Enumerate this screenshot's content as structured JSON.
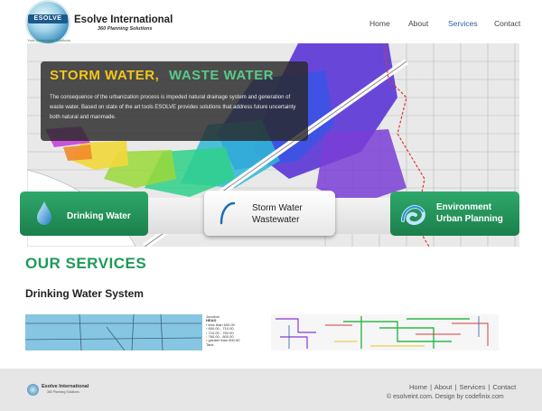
{
  "header": {
    "logo_band": "ESOLVE",
    "logo_tagline": "Your Sustainable Solutions",
    "brand_name": "Esolve International",
    "brand_sub": "360 Planning Solutions",
    "nav": [
      "Home",
      "About",
      "Services",
      "Contact"
    ],
    "active_nav": "Services"
  },
  "hero": {
    "title_part1": "STORM WATER,",
    "title_part2": "WASTE WATER",
    "text": "The consequence of the urbanization process is impeded natural drainage system and generation of waste water. Based on state of the art tools ESOLVE provides solutions that address future uncertainty both natural and manmade."
  },
  "service_cards": [
    {
      "label_line1": "Drinking Water",
      "label_line2": ""
    },
    {
      "label_line1": "Storm Water",
      "label_line2": "Wastewater"
    },
    {
      "label_line1": "Environment",
      "label_line2": "Urban Planning"
    }
  ],
  "services": {
    "heading": "OUR SERVICES",
    "subsection": "Drinking Water System",
    "legend_title": "Junction",
    "legend_sub": "HEAD",
    "legend_items": [
      "less than 600.00",
      "600.00 - 710.00",
      "710.00 - 760.00",
      "760.00 - 800.00",
      "greater than 800.00"
    ],
    "legend_footer": "Tank"
  },
  "footer": {
    "brand": "Esolve International",
    "brand_sub": "360 Planning Solutions",
    "links": [
      "Home",
      "About",
      "Services",
      "Contact"
    ],
    "copyright_prefix": "© esolveint.com. Design by",
    "designer": "codefinix.com"
  },
  "colors": {
    "accent_green": "#1e9a59",
    "nav_active": "#2a5da8",
    "hero_title_yellow": "#f3c61a",
    "hero_title_green": "#59c98a"
  },
  "icons": [
    "water-drop-icon",
    "storm-arc-icon",
    "environment-swirl-icon"
  ]
}
